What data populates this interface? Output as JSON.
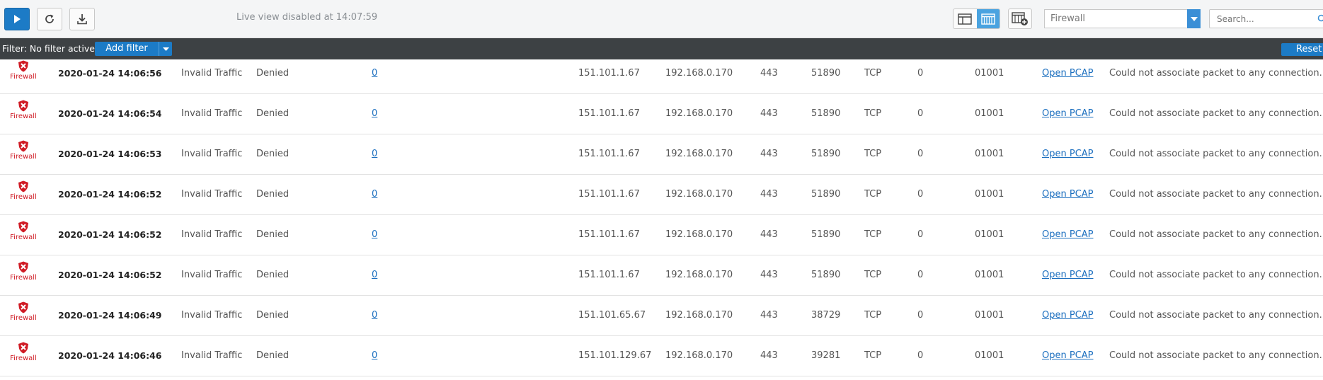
{
  "toolbar": {
    "live_status": "Live view disabled at 14:07:59",
    "module_select": {
      "value": "Firewall"
    },
    "search": {
      "placeholder": "Search..."
    }
  },
  "filter_bar": {
    "label": "Filter: No filter active",
    "add_filter_label": "Add filter",
    "reset_label": "Reset"
  },
  "colors": {
    "accent_blue": "#1c7bc6",
    "firewall_red": "#d01b25",
    "filter_bar_bg": "#3d4144",
    "link_blue": "#1c6fbf"
  },
  "rows": [
    {
      "icon": "firewall-shield-x-icon",
      "module": "Firewall",
      "time": "2020-01-24 14:06:56",
      "type": "Invalid Traffic",
      "action": "Denied",
      "hits": "0",
      "src_ip": "151.101.1.67",
      "dst_ip": "192.168.0.170",
      "dst_port": "443",
      "src_port": "51890",
      "protocol": "TCP",
      "count": "0",
      "rule": "01001",
      "pcap": "Open PCAP",
      "message": "Could not associate packet to any connection."
    },
    {
      "icon": "firewall-shield-x-icon",
      "module": "Firewall",
      "time": "2020-01-24 14:06:54",
      "type": "Invalid Traffic",
      "action": "Denied",
      "hits": "0",
      "src_ip": "151.101.1.67",
      "dst_ip": "192.168.0.170",
      "dst_port": "443",
      "src_port": "51890",
      "protocol": "TCP",
      "count": "0",
      "rule": "01001",
      "pcap": "Open PCAP",
      "message": "Could not associate packet to any connection."
    },
    {
      "icon": "firewall-shield-x-icon",
      "module": "Firewall",
      "time": "2020-01-24 14:06:53",
      "type": "Invalid Traffic",
      "action": "Denied",
      "hits": "0",
      "src_ip": "151.101.1.67",
      "dst_ip": "192.168.0.170",
      "dst_port": "443",
      "src_port": "51890",
      "protocol": "TCP",
      "count": "0",
      "rule": "01001",
      "pcap": "Open PCAP",
      "message": "Could not associate packet to any connection."
    },
    {
      "icon": "firewall-shield-x-icon",
      "module": "Firewall",
      "time": "2020-01-24 14:06:52",
      "type": "Invalid Traffic",
      "action": "Denied",
      "hits": "0",
      "src_ip": "151.101.1.67",
      "dst_ip": "192.168.0.170",
      "dst_port": "443",
      "src_port": "51890",
      "protocol": "TCP",
      "count": "0",
      "rule": "01001",
      "pcap": "Open PCAP",
      "message": "Could not associate packet to any connection."
    },
    {
      "icon": "firewall-shield-x-icon",
      "module": "Firewall",
      "time": "2020-01-24 14:06:52",
      "type": "Invalid Traffic",
      "action": "Denied",
      "hits": "0",
      "src_ip": "151.101.1.67",
      "dst_ip": "192.168.0.170",
      "dst_port": "443",
      "src_port": "51890",
      "protocol": "TCP",
      "count": "0",
      "rule": "01001",
      "pcap": "Open PCAP",
      "message": "Could not associate packet to any connection."
    },
    {
      "icon": "firewall-shield-x-icon",
      "module": "Firewall",
      "time": "2020-01-24 14:06:52",
      "type": "Invalid Traffic",
      "action": "Denied",
      "hits": "0",
      "src_ip": "151.101.1.67",
      "dst_ip": "192.168.0.170",
      "dst_port": "443",
      "src_port": "51890",
      "protocol": "TCP",
      "count": "0",
      "rule": "01001",
      "pcap": "Open PCAP",
      "message": "Could not associate packet to any connection."
    },
    {
      "icon": "firewall-shield-x-icon",
      "module": "Firewall",
      "time": "2020-01-24 14:06:49",
      "type": "Invalid Traffic",
      "action": "Denied",
      "hits": "0",
      "src_ip": "151.101.65.67",
      "dst_ip": "192.168.0.170",
      "dst_port": "443",
      "src_port": "38729",
      "protocol": "TCP",
      "count": "0",
      "rule": "01001",
      "pcap": "Open PCAP",
      "message": "Could not associate packet to any connection."
    },
    {
      "icon": "firewall-shield-x-icon",
      "module": "Firewall",
      "time": "2020-01-24 14:06:46",
      "type": "Invalid Traffic",
      "action": "Denied",
      "hits": "0",
      "src_ip": "151.101.129.67",
      "dst_ip": "192.168.0.170",
      "dst_port": "443",
      "src_port": "39281",
      "protocol": "TCP",
      "count": "0",
      "rule": "01001",
      "pcap": "Open PCAP",
      "message": "Could not associate packet to any connection."
    }
  ]
}
